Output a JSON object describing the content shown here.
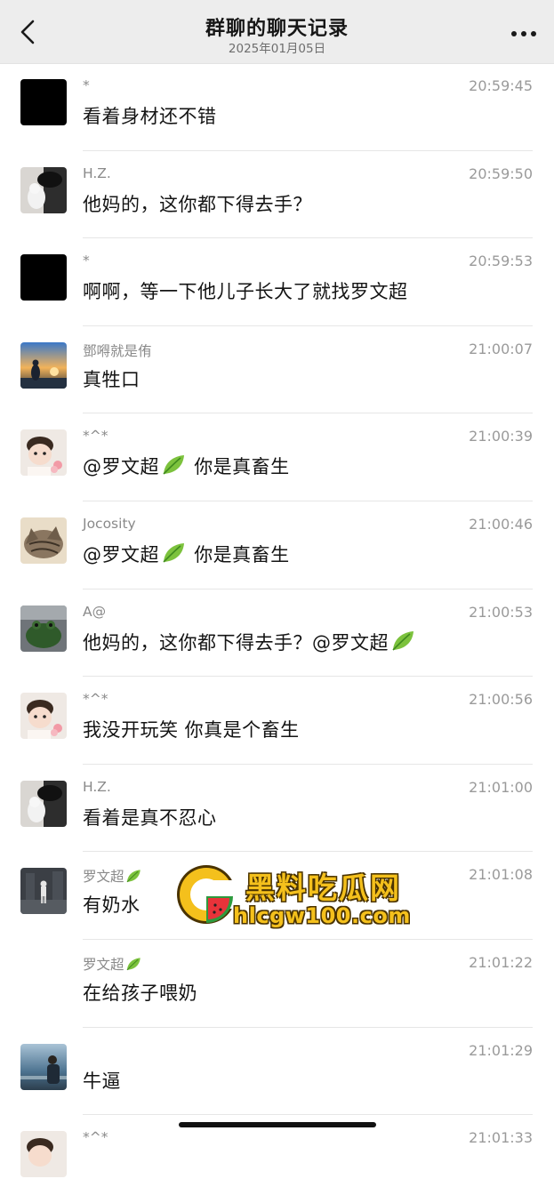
{
  "header": {
    "title": "群聊的聊天记录",
    "date": "2025年01月05日",
    "back_icon": "chevron-left-icon",
    "more_icon": "more-dots-icon"
  },
  "messages": [
    {
      "name": "*",
      "time": "20:59:45",
      "text": "看着身材还不错",
      "avatar": "black"
    },
    {
      "name": "H.Z.",
      "time": "20:59:50",
      "text": "他妈的，这你都下得去手？",
      "avatar": "cat-cap"
    },
    {
      "name": "*",
      "time": "20:59:53",
      "text": "啊啊，等一下他儿子长大了就找罗文超",
      "avatar": "black"
    },
    {
      "name": "鄧嘚就是侑",
      "time": "21:00:07",
      "text": "真牲口",
      "avatar": "sunset"
    },
    {
      "name": "*^*",
      "time": "21:00:39",
      "text_before": "@罗文超",
      "text_after": "你是真畜生",
      "avatar": "baby"
    },
    {
      "name": "Jocosity",
      "time": "21:00:46",
      "text_before": "@罗文超",
      "text_after": "你是真畜生",
      "avatar": "tabby-cat"
    },
    {
      "name": "A@",
      "time": "21:00:53",
      "text_before": "他妈的，这你都下得去手？@罗文超",
      "text_after": "",
      "avatar": "frog"
    },
    {
      "name": "*^*",
      "time": "21:00:56",
      "text": "我没开玩笑 你真是个畜生",
      "avatar": "baby"
    },
    {
      "name": "H.Z.",
      "time": "21:01:00",
      "text": "看着是真不忍心",
      "avatar": "cat-cap"
    },
    {
      "name": "罗文超",
      "time": "21:01:08",
      "text": "有奶水",
      "avatar": "street",
      "name_leaf": true
    },
    {
      "name": "罗文超",
      "time": "21:01:22",
      "text": "在给孩子喂奶",
      "avatar": "none",
      "name_leaf": true
    },
    {
      "name": "",
      "time": "21:01:29",
      "text": "牛逼",
      "avatar": "sea"
    },
    {
      "name": "*^*",
      "time": "21:01:33",
      "text": "",
      "avatar": "baby"
    }
  ],
  "watermark": {
    "line1": "黑料吃瓜网",
    "line2": "hlcgw100.com",
    "icon": "watermelon-logo-icon",
    "color": "#f4c01c"
  },
  "colors": {
    "header_bg": "#ededed",
    "name": "#8a8a8a",
    "time": "#9a9a9a",
    "divider": "#e6e6e6"
  }
}
